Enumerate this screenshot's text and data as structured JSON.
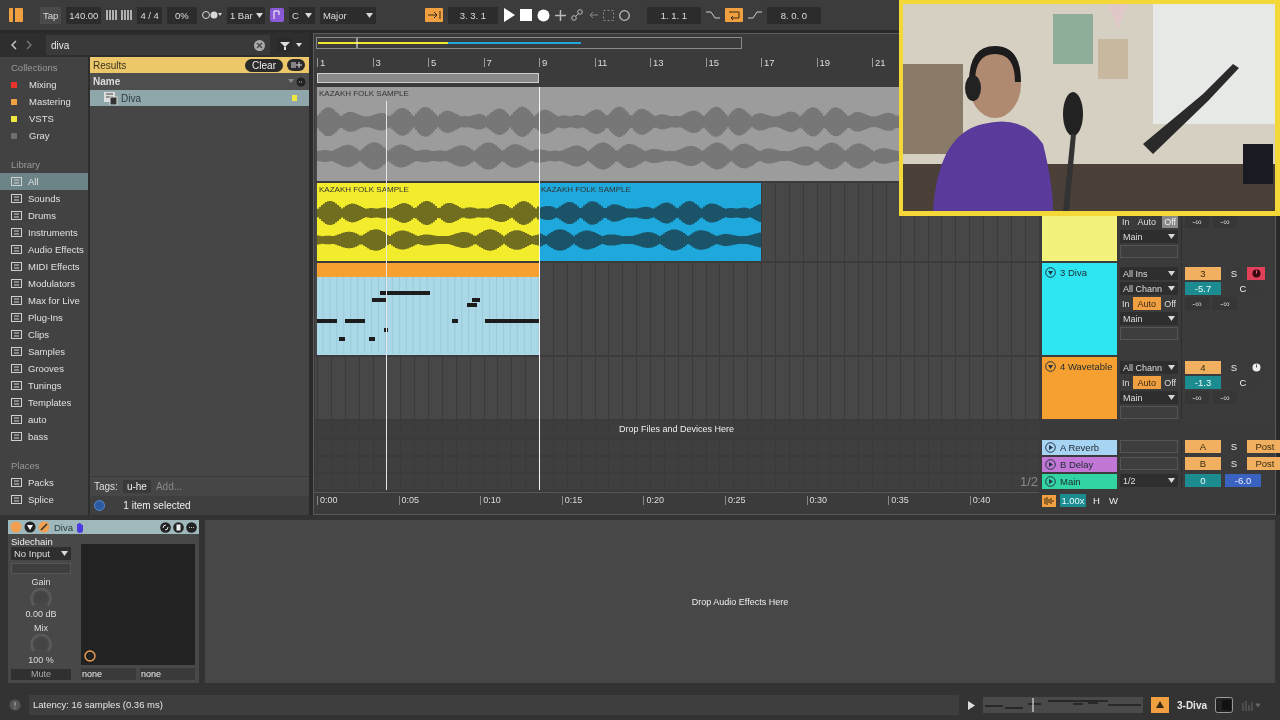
{
  "toolbar": {
    "tap": "Tap",
    "tempo": "140.00",
    "signature": "4 / 4",
    "groove": "0%",
    "quantization": "1 Bar",
    "key": "C",
    "scale": "Major",
    "follow": {
      "on": true
    },
    "position": "3. 3. 1",
    "loop_start": "1. 1. 1",
    "loop": {
      "on": true
    },
    "loop_length": "8. 0. 0"
  },
  "browser": {
    "search": "diva",
    "collections": {
      "title": "Collections",
      "items": [
        {
          "label": "Mixing",
          "color": "#e8322c"
        },
        {
          "label": "Mastering",
          "color": "#f0a040"
        },
        {
          "label": "VSTS",
          "color": "#f0e640"
        },
        {
          "label": "Gray",
          "color": "#6e6e6e"
        }
      ]
    },
    "library": {
      "title": "Library",
      "items": [
        {
          "label": "All",
          "selected": true
        },
        {
          "label": "Sounds",
          "selected": false
        },
        {
          "label": "Drums",
          "selected": false
        },
        {
          "label": "Instruments",
          "selected": false
        },
        {
          "label": "Audio Effects",
          "selected": false
        },
        {
          "label": "MIDI Effects",
          "selected": false
        },
        {
          "label": "Modulators",
          "selected": false
        },
        {
          "label": "Max for Live",
          "selected": false
        },
        {
          "label": "Plug-Ins",
          "selected": false
        },
        {
          "label": "Clips",
          "selected": false
        },
        {
          "label": "Samples",
          "selected": false
        },
        {
          "label": "Grooves",
          "selected": false
        },
        {
          "label": "Tunings",
          "selected": false
        },
        {
          "label": "Templates",
          "selected": false
        },
        {
          "label": "auto",
          "selected": false
        },
        {
          "label": "bass",
          "selected": false
        }
      ]
    },
    "places": {
      "title": "Places",
      "items": [
        {
          "label": "Packs",
          "selected": false
        },
        {
          "label": "Splice",
          "selected": false
        }
      ]
    },
    "results": {
      "title": "Results",
      "clear": "Clear",
      "column": "Name",
      "items": [
        {
          "name": "Diva",
          "selected": true,
          "color": "#f0e640"
        }
      ]
    },
    "tags": {
      "label": "Tags:",
      "items": [
        "u-he"
      ],
      "add": "Add..."
    },
    "status": "1 item selected"
  },
  "arrangement": {
    "ruler": [
      "1",
      "3",
      "5",
      "7",
      "9",
      "11",
      "13",
      "15",
      "17",
      "19",
      "21"
    ],
    "tracks": [
      {
        "clips": [
          {
            "kind": "audio",
            "name": "KAZAKH FOLK SAMPLE",
            "color": "#9c9c9c"
          }
        ]
      },
      {
        "color": "#f2f27c",
        "clips": [
          {
            "kind": "audio",
            "name": "KAZAKH FOLK SAMPLE",
            "color": "#f2ec2c"
          },
          {
            "kind": "audio",
            "name": "KAZAKH FOLK SAMPLE",
            "color": "#1ea8dc"
          }
        ],
        "io": [
          {
            "kind": "monitor",
            "options": [
              {
                "label": "In",
                "selected": false
              },
              {
                "label": "Auto",
                "selected": false
              },
              {
                "label": "Off",
                "selected": true
              }
            ]
          },
          {
            "kind": "dropdown",
            "value": "Main"
          },
          {
            "kind": "empty"
          }
        ],
        "mixer": [
          [
            {
              "kind": "peak",
              "text": "-∞"
            },
            {
              "kind": "peak",
              "text": "-∞"
            }
          ]
        ]
      },
      {
        "name": "3 Diva",
        "color": "#2ee6f2",
        "clips": [
          {
            "kind": "midi",
            "color": "#aad8e6"
          }
        ],
        "io": [
          {
            "kind": "dropdown",
            "value": "All Ins"
          },
          {
            "kind": "dropdown",
            "value": "All Chann"
          },
          {
            "kind": "monitor",
            "options": [
              {
                "label": "In",
                "selected": false
              },
              {
                "label": "Auto",
                "selected": true
              },
              {
                "label": "Off",
                "selected": false
              }
            ]
          },
          {
            "kind": "dropdown",
            "value": "Main"
          },
          {
            "kind": "empty"
          }
        ],
        "mixer": [
          [
            {
              "kind": "number",
              "text": "3"
            },
            {
              "kind": "solo",
              "text": "S"
            },
            {
              "kind": "arm",
              "on": true
            }
          ],
          [
            {
              "kind": "volume",
              "text": "-5.7"
            },
            {
              "kind": "pan",
              "text": "C"
            }
          ],
          [
            {
              "kind": "peak",
              "text": "-∞"
            },
            {
              "kind": "peak",
              "text": "-∞"
            }
          ]
        ]
      },
      {
        "name": "4 Wavetable",
        "color": "#f5a030",
        "io": [
          {
            "kind": "dropdown",
            "value": "All Chann"
          },
          {
            "kind": "monitor",
            "options": [
              {
                "label": "In",
                "selected": false
              },
              {
                "label": "Auto",
                "selected": true
              },
              {
                "label": "Off",
                "selected": false
              }
            ]
          },
          {
            "kind": "dropdown",
            "value": "Main"
          },
          {
            "kind": "empty"
          }
        ],
        "mixer": [
          [
            {
              "kind": "number",
              "text": "4"
            },
            {
              "kind": "solo",
              "text": "S"
            },
            {
              "kind": "arm",
              "on": false
            }
          ],
          [
            {
              "kind": "volume",
              "text": "-1.3"
            },
            {
              "kind": "pan",
              "text": "C"
            }
          ],
          [
            {
              "kind": "peak",
              "text": "-∞"
            },
            {
              "kind": "peak",
              "text": "-∞"
            }
          ]
        ]
      }
    ],
    "drop_hint": "Drop Files and Devices Here",
    "returns": [
      {
        "name": "A Reverb",
        "color": "#a8d4f4",
        "io": [
          {
            "kind": "empty"
          }
        ],
        "mixer": [
          [
            {
              "kind": "send",
              "text": "A"
            },
            {
              "kind": "solo",
              "text": "S"
            },
            {
              "kind": "send",
              "text": "Post"
            }
          ]
        ]
      },
      {
        "name": "B Delay",
        "color": "#c276d6",
        "io": [
          {
            "kind": "empty"
          }
        ],
        "mixer": [
          [
            {
              "kind": "send",
              "text": "B"
            },
            {
              "kind": "solo",
              "text": "S"
            },
            {
              "kind": "send",
              "text": "Post"
            }
          ]
        ]
      },
      {
        "name": "Main",
        "color": "#32d4a4",
        "page": "1/2",
        "io": [
          {
            "kind": "dropdown",
            "value": "1/2"
          }
        ],
        "mixer": [
          [
            {
              "kind": "volume",
              "text": "0"
            },
            {
              "kind": "cue",
              "text": "-6.0"
            }
          ]
        ]
      }
    ],
    "time_ruler": [
      "0:00",
      "0:05",
      "0:10",
      "0:15",
      "0:20",
      "0:25",
      "0:30",
      "0:35",
      "0:40"
    ],
    "zoom": "1.00x",
    "h_button": "H",
    "w_button": "W"
  },
  "device": {
    "name": "Diva",
    "on": true,
    "sidechain_label": "Sidechain",
    "sidechain_input": "No Input",
    "gain_label": "Gain",
    "gain": {
      "value": "0.00 dB"
    },
    "mix_label": "Mix",
    "mix": {
      "value": "100 %"
    },
    "mute": "Mute",
    "x_param": "none",
    "y_param": "none"
  },
  "device_drop_hint": "Drop Audio Effects Here",
  "status_bar": {
    "latency": "Latency: 16 samples (0.36 ms)",
    "track": "3-Diva"
  }
}
